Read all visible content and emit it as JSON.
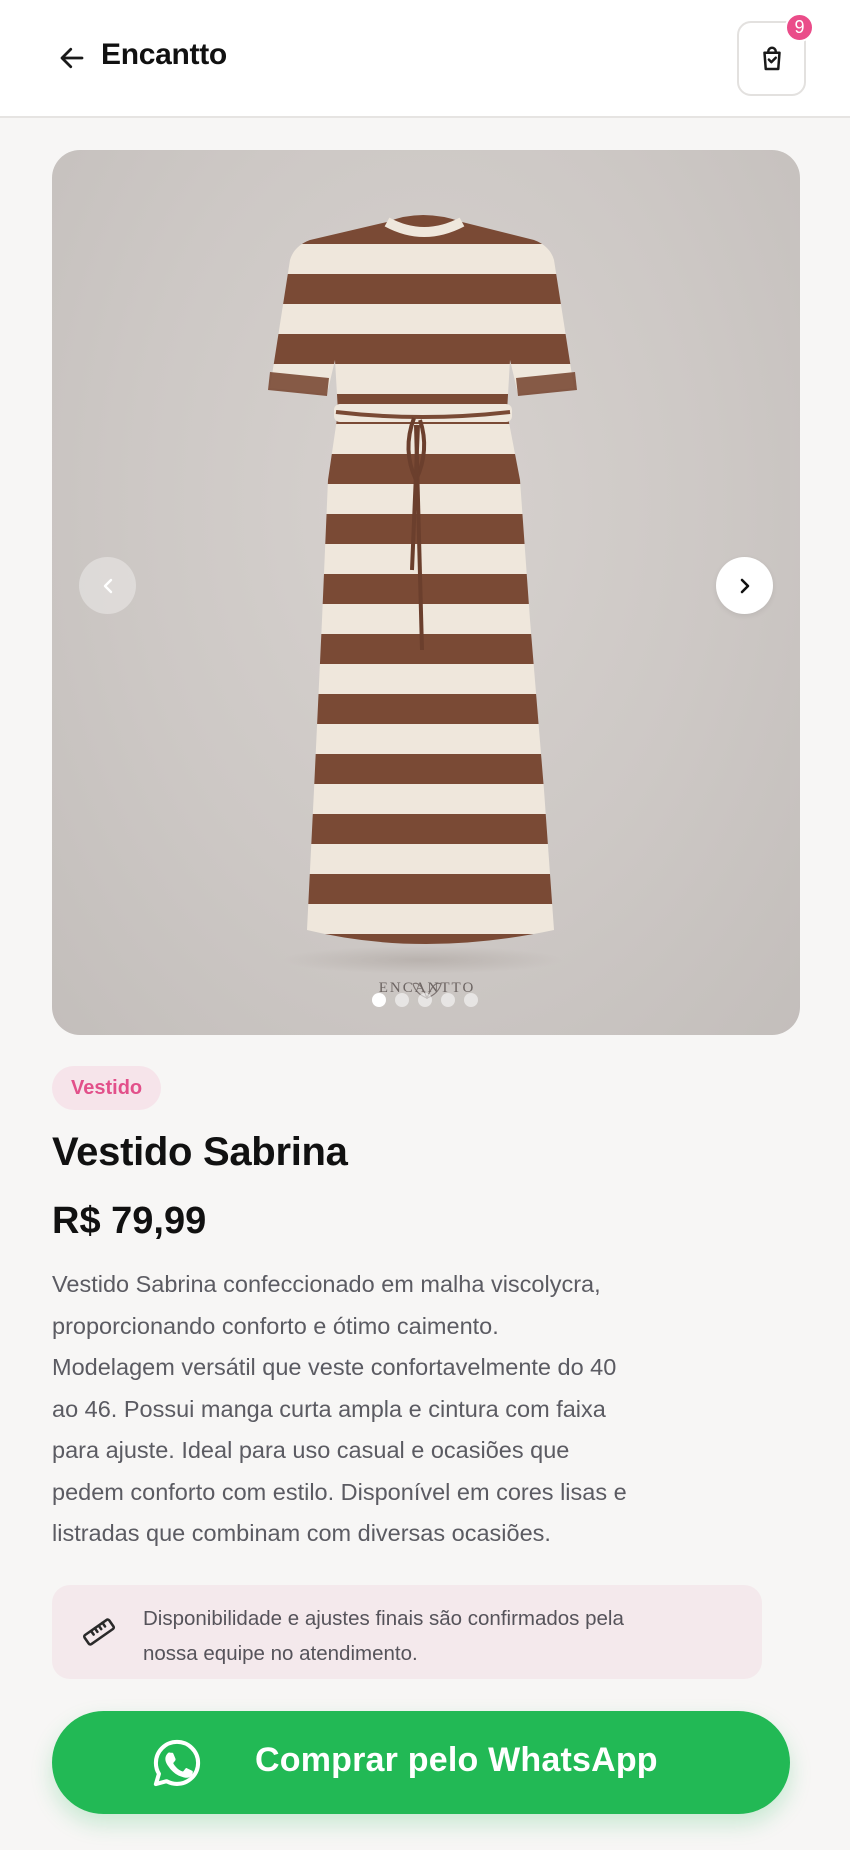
{
  "header": {
    "brand": "Encantto",
    "cart_count": "9"
  },
  "gallery": {
    "watermark": "ENCANTTO",
    "image_count": 5,
    "active_index": 0
  },
  "product": {
    "category": "Vestido",
    "title": "Vestido Sabrina",
    "price": "R$ 79,99",
    "description_lines": [
      "Vestido Sabrina confeccionado em malha viscolycra,",
      "proporcionando conforto e ótimo caimento.",
      "Modelagem versátil que veste confortavelmente do 40",
      "ao 46. Possui manga curta ampla e cintura com faixa",
      "para ajuste. Ideal para uso casual e ocasiões que",
      "pedem conforto com estilo. Disponível em cores lisas e",
      "listradas que combinam com diversas ocasiões."
    ]
  },
  "notice": {
    "lines": [
      "Disponibilidade e ajustes finais são confirmados pela",
      "nossa equipe no atendimento."
    ]
  },
  "cta": {
    "label": "Comprar pelo WhatsApp"
  },
  "icons": {
    "back": "arrow-left-icon",
    "cart": "shopping-bag-icon",
    "prev": "chevron-left-icon",
    "next": "chevron-right-icon",
    "notice": "ruler-icon",
    "cta": "whatsapp-icon"
  },
  "colors": {
    "accent_pink": "#ea4c89",
    "whatsapp_green": "#22b955",
    "dress_brown": "#7a4a35",
    "dress_cream": "#efe7dc"
  }
}
